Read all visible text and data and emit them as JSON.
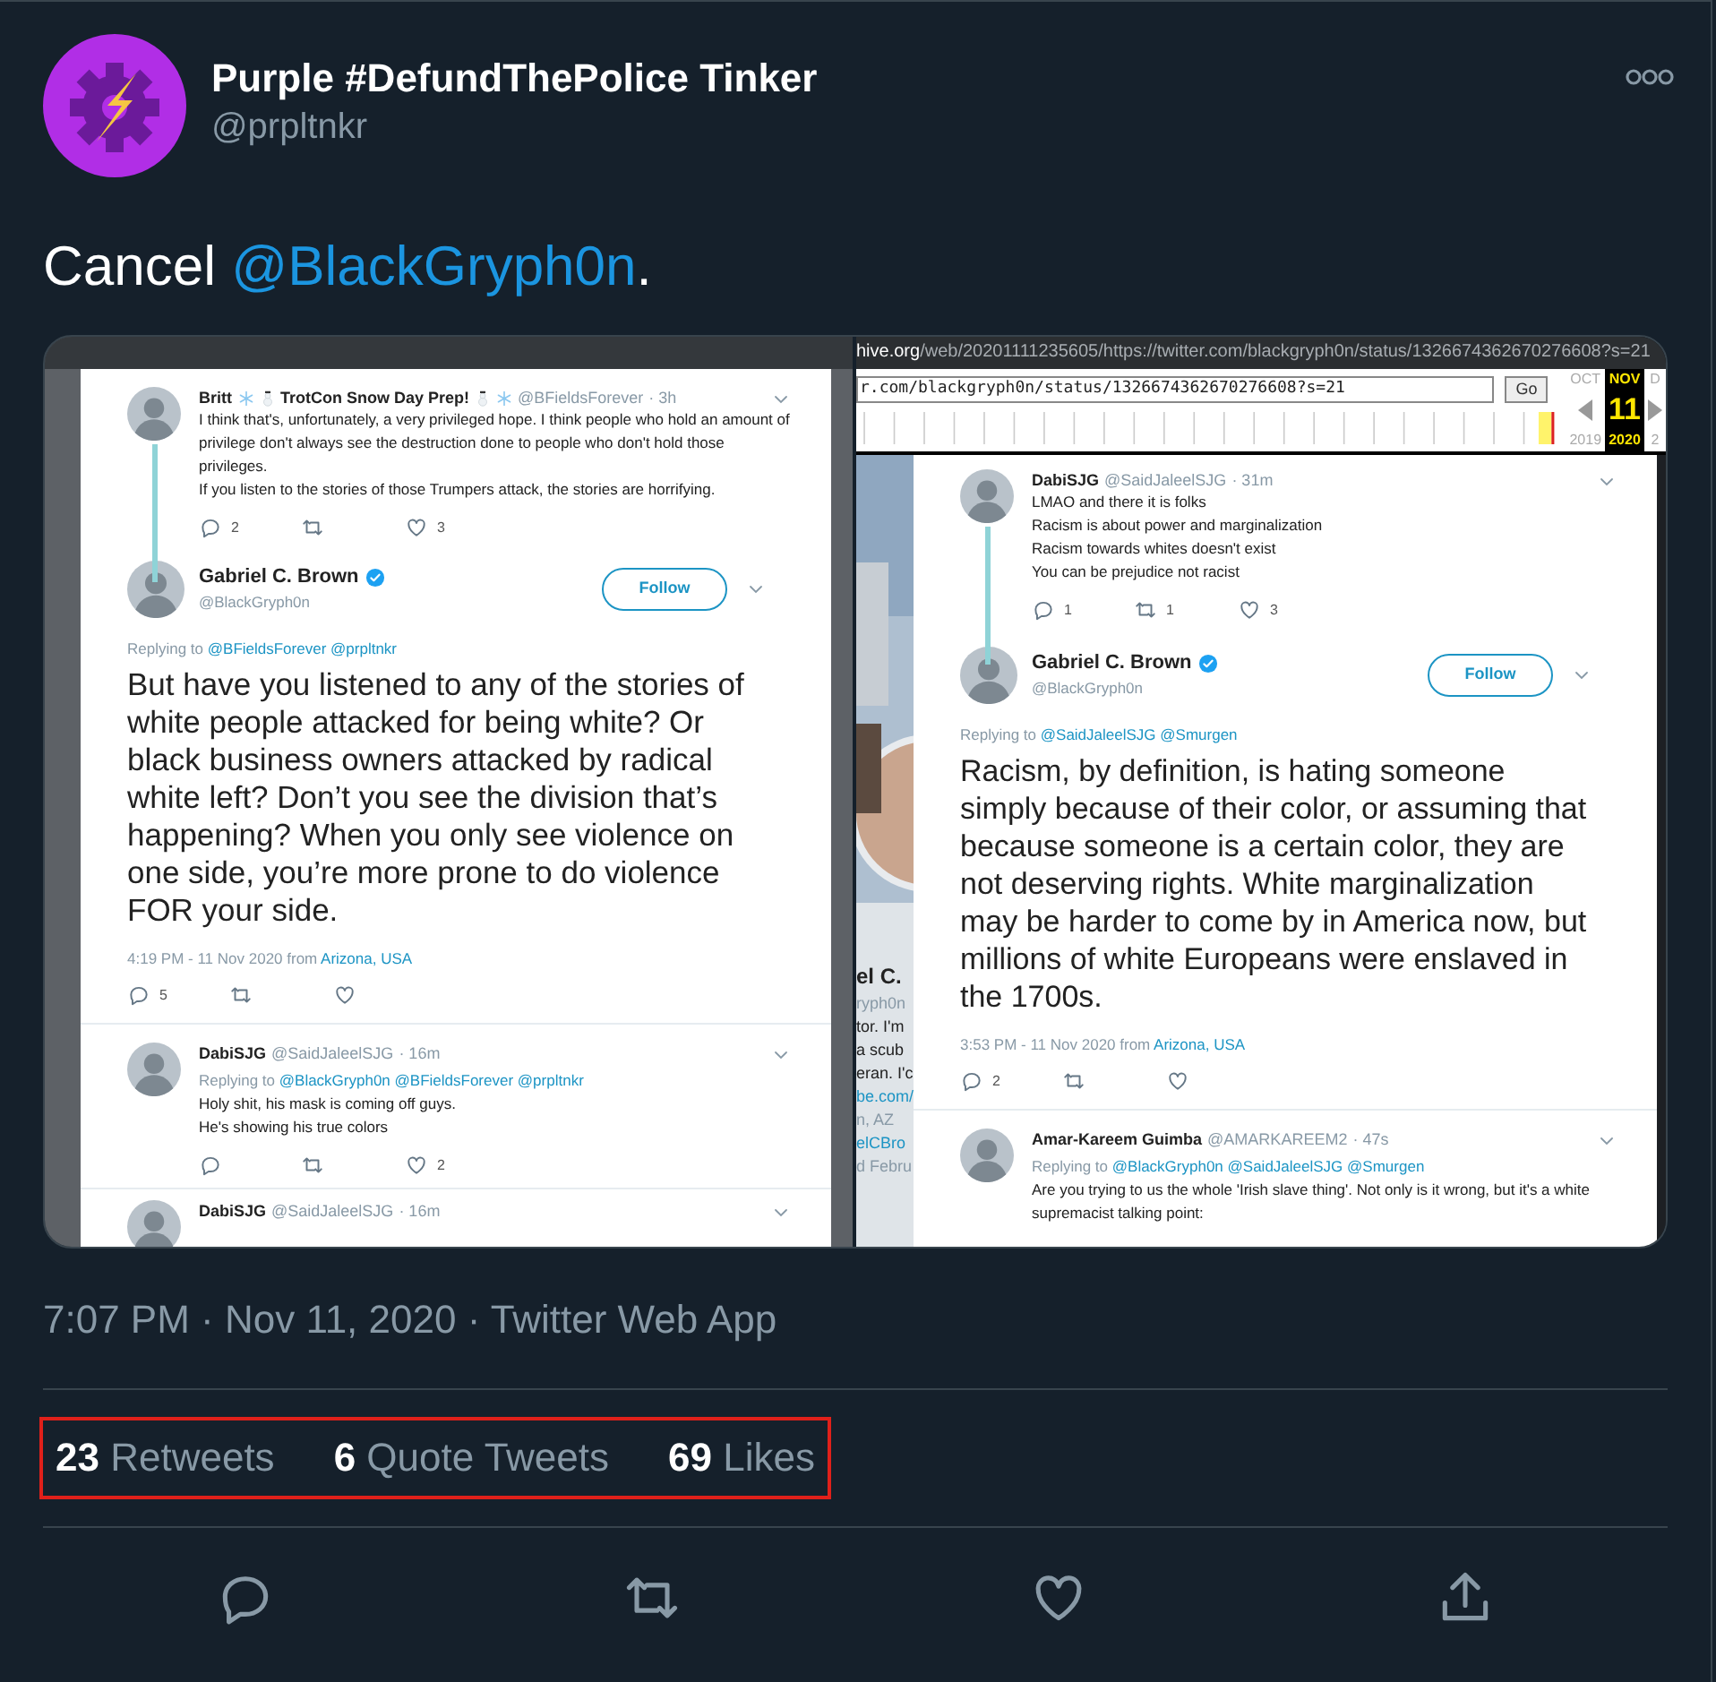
{
  "author": {
    "name": "Purple #DefundThePolice Tinker",
    "handle": "@prpltnkr"
  },
  "text": [
    {
      "kind": "plain",
      "text": "Cancel "
    },
    {
      "kind": "mention",
      "text": "@BlackGryph0n"
    },
    {
      "kind": "plain",
      "text": "."
    }
  ],
  "media": [
    {
      "kind": "thread",
      "items": [
        {
          "kind": "reply",
          "name": "Britt",
          "name_suffix": "TrotCon Snow Day Prep!",
          "name_emoji": true,
          "handle": "@BFieldsForever",
          "time": "· 3h",
          "thread": true,
          "lines": [
            "I think that's, unfortunately, a very privileged hope. I think people who hold an amount of privilege don't always see the destruction done to people who don't hold those privileges.",
            "If you listen to the stories of those Trumpers attack, the stories are horrifying."
          ],
          "counts": {
            "replies": "2",
            "likes": "3"
          }
        },
        {
          "kind": "focus",
          "name": "Gabriel C. Brown",
          "verified": true,
          "handle": "@BlackGryph0n",
          "follow": "Follow",
          "replying_label": "Replying to",
          "replying": [
            "@BFieldsForever",
            "@prpltnkr"
          ],
          "body": "But have you listened to any of the stories of white people attacked for being white? Or black business owners attacked by radical white left? Don’t you see the division that’s happening? When you only see violence on one side, you’re more prone to do violence FOR your side.",
          "timestamp": "4:19 PM - 11 Nov 2020 from",
          "location": "Arizona, USA",
          "counts": {
            "replies": "5"
          }
        },
        {
          "kind": "reply",
          "name": "DabiSJG",
          "handle": "@SaidJaleelSJG",
          "time": "· 16m",
          "thread": false,
          "replying_label": "Replying to",
          "replying": [
            "@BlackGryph0n",
            "@BFieldsForever",
            "@prpltnkr"
          ],
          "lines": [
            "Holy shit, his mask is coming off guys.",
            "He's showing his true colors"
          ],
          "counts": {
            "likes": "2"
          }
        },
        {
          "kind": "reply",
          "name": "DabiSJG",
          "handle": "@SaidJaleelSJG",
          "time": "· 16m",
          "thread": false
        }
      ]
    },
    {
      "kind": "archive",
      "archive": {
        "url_host": "hive.org",
        "url_path": "/web/20201111235605/https://twitter.com/blackgryph0n/status/1326674362670276608?s=21",
        "field": "r.com/blackgryph0n/status/1326674362670276608?s=21",
        "go": "Go",
        "calendar": [
          {
            "month": "OCT",
            "year": "2019",
            "selected": false
          },
          {
            "month": "NOV",
            "day": "11",
            "year": "2020",
            "selected": true
          },
          {
            "month": "D",
            "year": "2",
            "selected": false
          }
        ]
      },
      "fragments": [
        {
          "kind": "name",
          "text": "el C."
        },
        {
          "kind": "muted",
          "text": "ryph0n"
        },
        {
          "kind": "text",
          "text": "tor. I'm"
        },
        {
          "kind": "text",
          "text": "a scub"
        },
        {
          "kind": "text",
          "text": "eran. I'c"
        },
        {
          "kind": "link",
          "text": "be.com/"
        },
        {
          "kind": "muted",
          "text": "n, AZ"
        },
        {
          "kind": "link",
          "text": "elCBro"
        },
        {
          "kind": "muted",
          "text": "d Febru"
        }
      ],
      "items": [
        {
          "kind": "reply",
          "name": "DabiSJG",
          "handle": "@SaidJaleelSJG",
          "time": "· 31m",
          "thread": true,
          "lines": [
            "LMAO and there it is folks",
            "Racism is about power and marginalization",
            "Racism towards whites doesn't exist",
            "You can be prejudice not racist"
          ],
          "counts": {
            "replies": "1",
            "retweets": "1",
            "likes": "3"
          }
        },
        {
          "kind": "focus",
          "name": "Gabriel C. Brown",
          "verified": true,
          "handle": "@BlackGryph0n",
          "follow": "Follow",
          "replying_label": "Replying to",
          "replying": [
            "@SaidJaleelSJG",
            "@Smurgen"
          ],
          "body": "Racism, by definition, is hating someone simply because of their color, or assuming that because someone is a certain color, they are not deserving rights. White marginalization may be harder to come by in America now, but millions of white Europeans were enslaved in the 1700s.",
          "timestamp": "3:53 PM - 11 Nov 2020 from",
          "location": "Arizona, USA",
          "counts": {
            "replies": "2"
          }
        },
        {
          "kind": "reply",
          "name": "Amar-Kareem Guimba",
          "handle": "@AMARKAREEM2",
          "time": "· 47s",
          "thread": false,
          "replying_label": "Replying to",
          "replying": [
            "@BlackGryph0n",
            "@SaidJaleelSJG",
            "@Smurgen"
          ],
          "lines": [
            "Are you trying to us the whole 'Irish slave thing'. Not only is it wrong, but it's a white supremacist talking point:"
          ]
        }
      ]
    }
  ],
  "meta": "7:07 PM · Nov 11, 2020 · Twitter Web App",
  "stats_highlighted": true,
  "stats": [
    {
      "count": "23",
      "label": "Retweets"
    },
    {
      "count": "6",
      "label": "Quote Tweets"
    },
    {
      "count": "69",
      "label": "Likes"
    }
  ]
}
